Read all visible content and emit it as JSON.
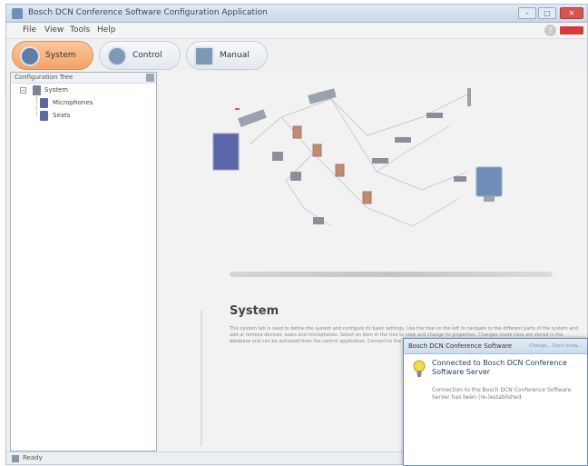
{
  "window": {
    "title": "Bosch DCN Conference Software Configuration Application"
  },
  "menu": {
    "items": [
      "File",
      "View",
      "Tools",
      "Help"
    ],
    "help_glyph": "?"
  },
  "window_buttons": {
    "minimize": "–",
    "maximize": "□",
    "close": "✕"
  },
  "toolbar": {
    "buttons": [
      {
        "label": "System",
        "icon": "system-icon",
        "active": true
      },
      {
        "label": "Control",
        "icon": "control-icon",
        "active": false
      },
      {
        "label": "Manual",
        "icon": "manual-icon",
        "active": false
      }
    ]
  },
  "tree": {
    "header": "Configuration Tree",
    "nodes": [
      {
        "label": "System",
        "expander": "−"
      },
      {
        "label": "Microphones"
      },
      {
        "label": "Seats"
      }
    ]
  },
  "status": {
    "text": "Ready"
  },
  "content": {
    "title": "System",
    "description": "This system tab is used to define the system and configure its basic settings. Use the tree on the left to navigate to the different parts of the system and add or remove devices, seats and microphones. Select an item in the tree to view and change its properties. Changes made here are stored in the database and can be activated from the control application. Connect to the conference software server to enable all configuration options."
  },
  "notification": {
    "title": "Bosch DCN Conference Software",
    "links": "Change... Don't show...",
    "heading": "Connected to Bosch DCN Conference Software Server",
    "body": "Connection to the Bosch DCN Conference Software Server has been (re-)established.",
    "icon": "lightbulb-icon"
  },
  "colors": {
    "accent": "#f3a36b",
    "brand": "#d83a3a",
    "notification_border": "#6f8db6"
  }
}
